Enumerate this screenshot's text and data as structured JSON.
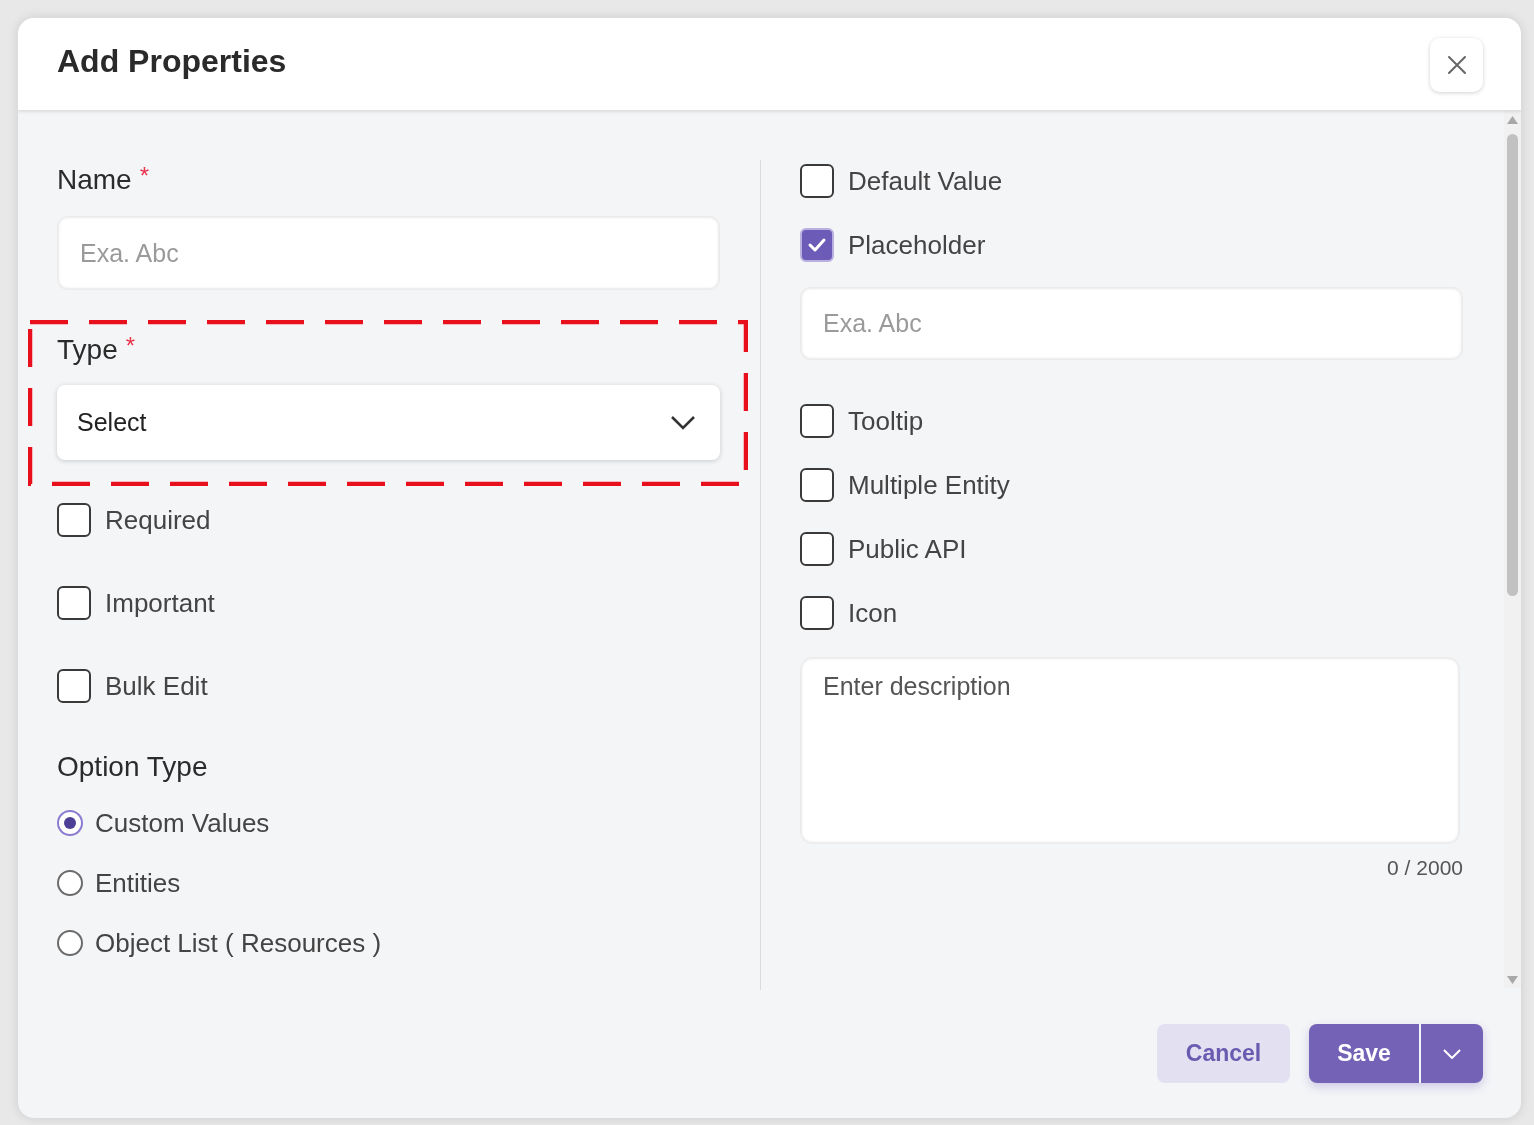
{
  "dialog": {
    "title": "Add Properties"
  },
  "name_field": {
    "label": "Name",
    "required_mark": "*",
    "placeholder": "Exa. Abc"
  },
  "type_field": {
    "label": "Type",
    "required_mark": "*",
    "value": "Select"
  },
  "left_options": [
    {
      "label": "Required",
      "checked": false
    },
    {
      "label": "Important",
      "checked": false
    },
    {
      "label": "Bulk Edit",
      "checked": false
    }
  ],
  "option_type": {
    "heading": "Option Type",
    "options": [
      {
        "label": "Custom Values",
        "selected": true
      },
      {
        "label": "Entities",
        "selected": false
      },
      {
        "label": "Object List ( Resources )",
        "selected": false
      }
    ]
  },
  "right_options": [
    {
      "kind": "checkbox",
      "label": "Default Value",
      "checked": false
    },
    {
      "kind": "checkbox",
      "label": "Placeholder",
      "checked": true
    },
    {
      "kind": "input",
      "placeholder": "Exa. Abc"
    },
    {
      "kind": "checkbox",
      "label": "Tooltip",
      "checked": false
    },
    {
      "kind": "checkbox",
      "label": "Multiple Entity",
      "checked": false
    },
    {
      "kind": "checkbox",
      "label": "Public API",
      "checked": false
    },
    {
      "kind": "checkbox",
      "label": "Icon",
      "checked": false
    }
  ],
  "description": {
    "placeholder": "Enter description",
    "counter": "0 / 2000"
  },
  "buttons": {
    "cancel": "Cancel",
    "save": "Save"
  }
}
